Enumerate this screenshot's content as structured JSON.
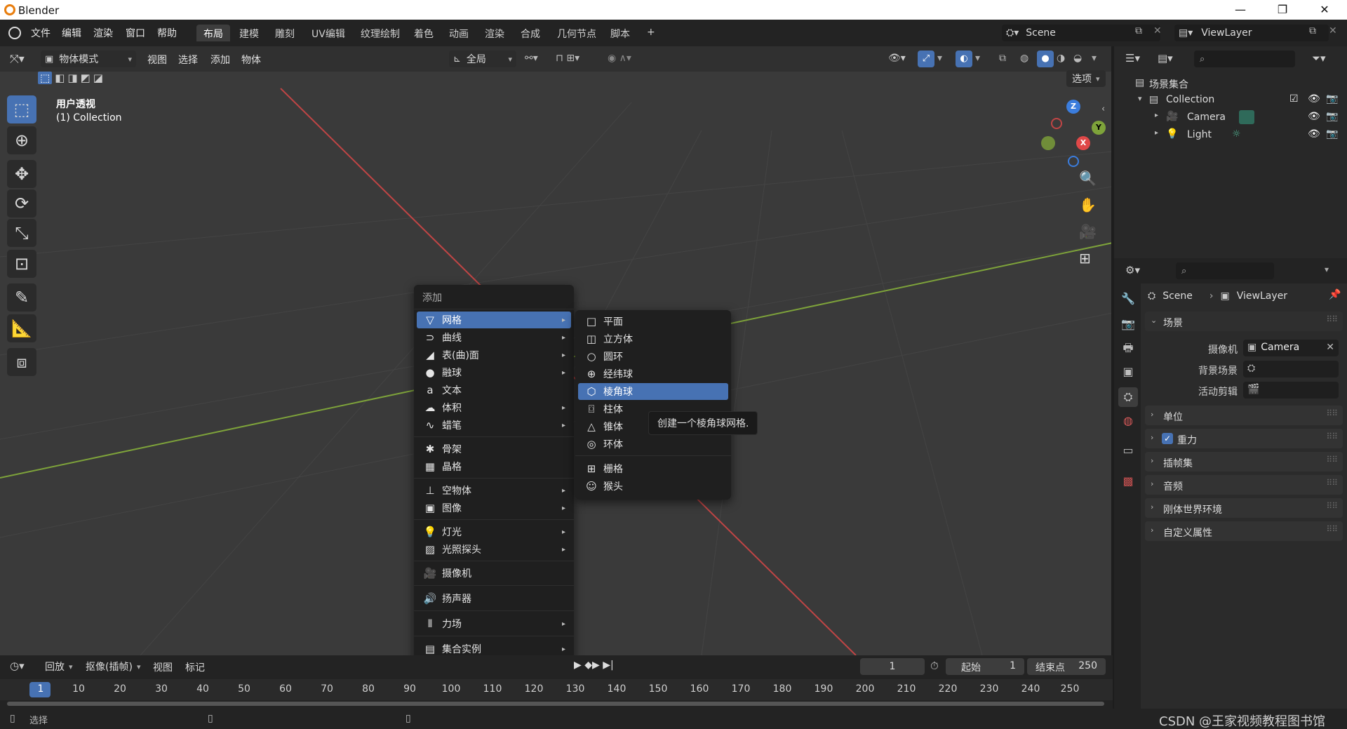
{
  "window": {
    "title": "Blender",
    "minimize": "—",
    "maximize": "❐",
    "close": "✕"
  },
  "menu": [
    "文件",
    "编辑",
    "渲染",
    "窗口",
    "帮助"
  ],
  "workspaces": [
    "布局",
    "建模",
    "雕刻",
    "UV编辑",
    "纹理绘制",
    "着色",
    "动画",
    "渲染",
    "合成",
    "几何节点",
    "脚本"
  ],
  "workspace_add": "+",
  "scene_field": "Scene",
  "viewlayer_field": "ViewLayer",
  "viewport": {
    "mode": "物体模式",
    "menus": [
      "视图",
      "选择",
      "添加",
      "物体"
    ],
    "transform_orientation": "全局",
    "options": "选项",
    "overlay_title": "用户透视",
    "overlay_subtitle": "(1) Collection",
    "gizmo_z": "Z",
    "gizmo_y": "Y",
    "gizmo_x": "X"
  },
  "add_menu": {
    "title": "添加",
    "items": [
      {
        "label": "网格",
        "icon": "▽",
        "arrow": "▸"
      },
      {
        "label": "曲线",
        "icon": "⊃",
        "arrow": "▸"
      },
      {
        "label": "表(曲)面",
        "icon": "◢",
        "arrow": "▸"
      },
      {
        "label": "融球",
        "icon": "●",
        "arrow": "▸"
      },
      {
        "label": "文本",
        "icon": "a",
        "arrow": ""
      },
      {
        "label": "体积",
        "icon": "☁",
        "arrow": "▸"
      },
      {
        "label": "蜡笔",
        "icon": "∿",
        "arrow": "▸"
      },
      {
        "label": "骨架",
        "icon": "✱",
        "arrow": ""
      },
      {
        "label": "晶格",
        "icon": "▦",
        "arrow": ""
      },
      {
        "label": "空物体",
        "icon": "⊥",
        "arrow": "▸"
      },
      {
        "label": "图像",
        "icon": "▣",
        "arrow": "▸"
      },
      {
        "label": "灯光",
        "icon": "💡",
        "arrow": "▸"
      },
      {
        "label": "光照探头",
        "icon": "▨",
        "arrow": "▸"
      },
      {
        "label": "摄像机",
        "icon": "🎥",
        "arrow": ""
      },
      {
        "label": "扬声器",
        "icon": "🔊",
        "arrow": ""
      },
      {
        "label": "力场",
        "icon": "⫴",
        "arrow": "▸"
      },
      {
        "label": "集合实例",
        "icon": "▤",
        "arrow": "▸"
      }
    ]
  },
  "mesh_menu": {
    "items": [
      {
        "label": "平面",
        "icon": "□"
      },
      {
        "label": "立方体",
        "icon": "◫"
      },
      {
        "label": "圆环",
        "icon": "○"
      },
      {
        "label": "经纬球",
        "icon": "⊕"
      },
      {
        "label": "棱角球",
        "icon": "⬡"
      },
      {
        "label": "柱体",
        "icon": "⌼"
      },
      {
        "label": "锥体",
        "icon": "△"
      },
      {
        "label": "环体",
        "icon": "◎"
      },
      {
        "label": "栅格",
        "icon": "⊞"
      },
      {
        "label": "猴头",
        "icon": "☺"
      }
    ],
    "tooltip": "创建一个棱角球网格."
  },
  "timeline": {
    "playback": "回放",
    "keying": "抠像(插帧)",
    "view": "视图",
    "marker": "标记",
    "current_frame": "1",
    "start_label": "起始",
    "start": "1",
    "end_label": "结束点",
    "end": "250",
    "ticks": [
      "1",
      "10",
      "20",
      "30",
      "40",
      "50",
      "60",
      "70",
      "80",
      "90",
      "100",
      "110",
      "120",
      "130",
      "140",
      "150",
      "160",
      "170",
      "180",
      "190",
      "200",
      "210",
      "220",
      "230",
      "240",
      "250"
    ]
  },
  "statusbar": {
    "select": "选择",
    "watermark": "CSDN @王家视频教程图书馆"
  },
  "outliner": {
    "root": "场景集合",
    "collection": "Collection",
    "objects": [
      "Camera",
      "Light"
    ]
  },
  "properties": {
    "breadcrumb_scene": "Scene",
    "breadcrumb_sep": "›",
    "breadcrumb_layer": "ViewLayer",
    "scene_panel": "场景",
    "camera_label": "摄像机",
    "camera_value": "Camera",
    "bg_scene_label": "背景场景",
    "active_clip_label": "活动剪辑",
    "panels": [
      "单位",
      "重力",
      "插帧集",
      "音频",
      "刚体世界环境",
      "自定义属性"
    ]
  },
  "colors": {
    "accent": "#4772b3",
    "x_axis": "#c04545",
    "y_axis": "#7ea33a",
    "z_axis": "#3b7ddd"
  }
}
